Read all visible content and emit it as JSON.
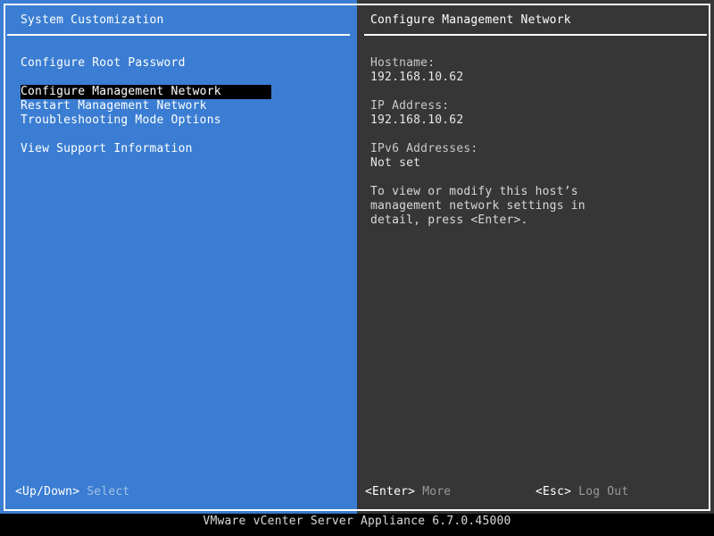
{
  "left": {
    "title": "System Customization",
    "menu": [
      {
        "label": "Configure Root Password",
        "selected": false
      },
      {
        "label": "Configure Management Network",
        "selected": true
      },
      {
        "label": "Restart Management Network",
        "selected": false
      },
      {
        "label": "Troubleshooting Mode Options",
        "selected": false
      },
      {
        "label": "View Support Information",
        "selected": false
      }
    ],
    "hint": {
      "key": "<Up/Down>",
      "label": "Select"
    }
  },
  "right": {
    "title": "Configure Management Network",
    "hostname_label": "Hostname:",
    "hostname_value": "192.168.10.62",
    "ip_label": "IP Address:",
    "ip_value": "192.168.10.62",
    "ipv6_label": "IPv6 Addresses:",
    "ipv6_value": "Not set",
    "description": [
      "To view or modify this host’s",
      "management network settings in",
      "detail, press <Enter>."
    ],
    "hint_enter": {
      "key": "<Enter>",
      "label": "More"
    },
    "hint_esc": {
      "key": "<Esc>",
      "label": "Log Out"
    }
  },
  "status_bar": "VMware vCenter Server Appliance 6.7.0.45000",
  "colors": {
    "left_panel_bg": "#3a7dd2",
    "right_panel_bg": "#363636",
    "selection_bg": "#000000",
    "screen_bg": "#000000"
  }
}
